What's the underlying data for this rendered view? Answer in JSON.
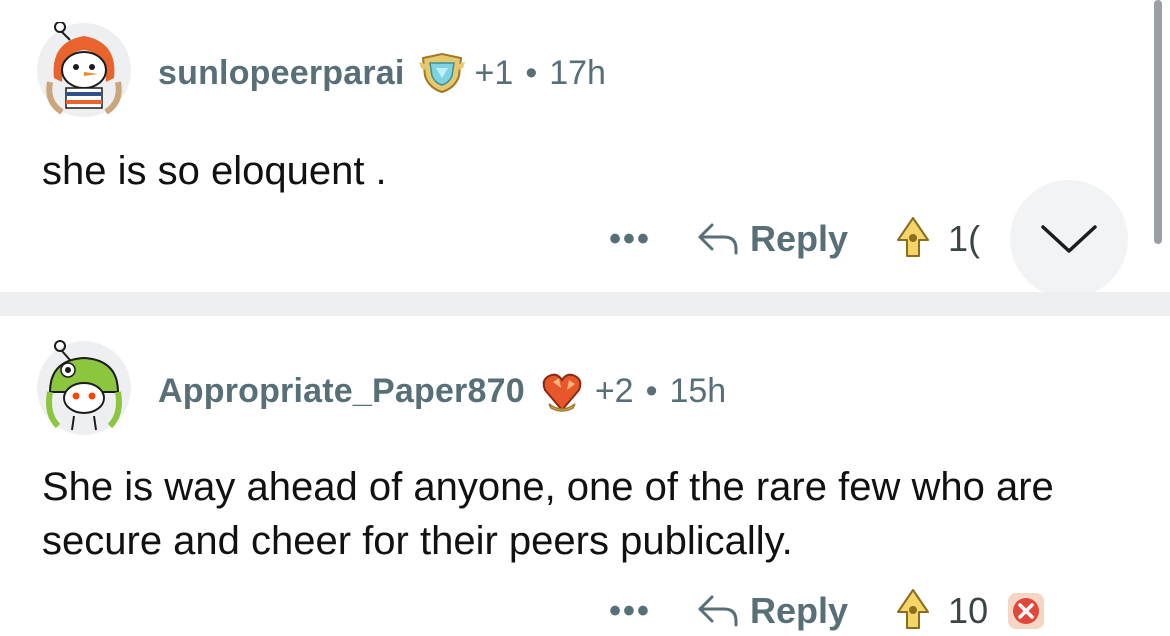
{
  "comments": [
    {
      "username": "sunlopeerparai",
      "award_icon": "gem-shield-award-icon",
      "award_count": "+1",
      "separator_dot": "•",
      "time": "17h",
      "body": "she is so eloquent .",
      "more_label": "•••",
      "reply_label": "Reply",
      "vote_count": "1("
    },
    {
      "username": "Appropriate_Paper870",
      "award_icon": "crystal-heart-award-icon",
      "award_count": "+2",
      "separator_dot": "•",
      "time": "15h",
      "body": "She is way ahead of anyone, one of the rare few who are secure and cheer for their peers publically.",
      "more_label": "•••",
      "reply_label": "Reply",
      "vote_count": "10"
    }
  ],
  "icons": {
    "avatar_1": "snowman-hood-avatar",
    "avatar_2": "frog-hat-avatar",
    "reply": "reply-arrow-icon",
    "upvote": "upvote-icon",
    "downvote": "downvote-icon",
    "collapse": "chevron-down-icon"
  },
  "colors": {
    "meta_text": "#576f76",
    "separator": "#edeff1",
    "downvote": "#e0483b"
  }
}
